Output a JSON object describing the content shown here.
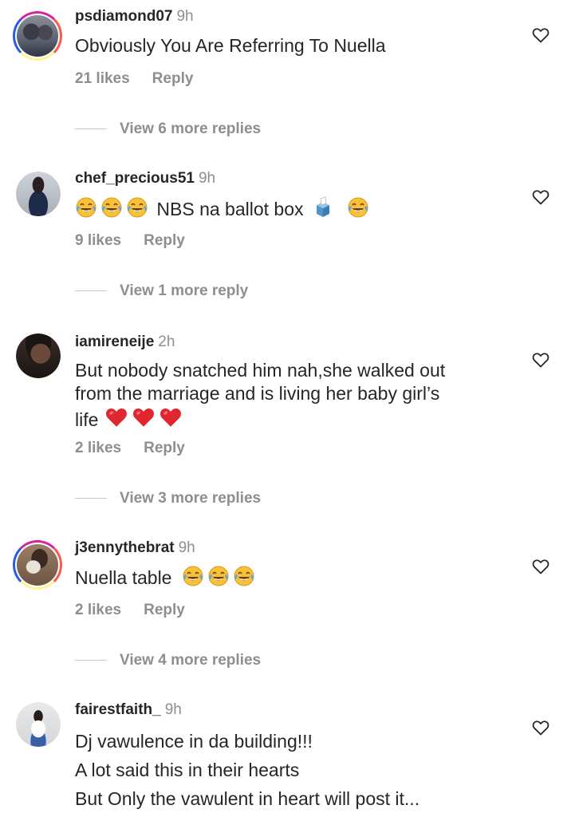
{
  "comments": [
    {
      "username": "psdiamond07",
      "time": "9h",
      "text": "Obviously You Are Referring To Nuella",
      "likes": "21 likes",
      "reply": "Reply",
      "more_replies": "View 6 more replies",
      "avatar_icon": "avatar-story-ring"
    },
    {
      "username": "chef_precious51",
      "time": "9h",
      "text": "NBS na ballot box",
      "likes": "9 likes",
      "reply": "Reply",
      "more_replies": "View 1 more reply",
      "avatar_icon": "avatar"
    },
    {
      "username": "iamireneije",
      "time": "2h",
      "text_line1": "But nobody snatched him nah,she walked out",
      "text_line2": "from the marriage and is living her baby girl’s",
      "text_line3": "life",
      "likes": "2 likes",
      "reply": "Reply",
      "more_replies": "View 3 more replies",
      "avatar_icon": "avatar"
    },
    {
      "username": "j3ennythebrat",
      "time": "9h",
      "text": "Nuella table",
      "likes": "2 likes",
      "reply": "Reply",
      "more_replies": "View 4 more replies",
      "avatar_icon": "avatar-story-ring"
    },
    {
      "username": "fairestfaith_",
      "time": "9h",
      "text_line1": "Dj vawulence in da building!!!",
      "text_line2": "A lot said this in their hearts",
      "text_line3": "But Only the vawulent in heart will post it...",
      "avatar_icon": "avatar"
    }
  ],
  "icons": {
    "like": "heart-outline-icon",
    "laugh": "tears-of-joy-emoji",
    "ballot": "ballot-box-emoji",
    "love": "red-heart-emoji"
  },
  "colors": {
    "text": "#262626",
    "secondary": "#8e8e8e",
    "heart_emoji": "#e0262f",
    "laugh_emoji": "#f7c13a"
  }
}
